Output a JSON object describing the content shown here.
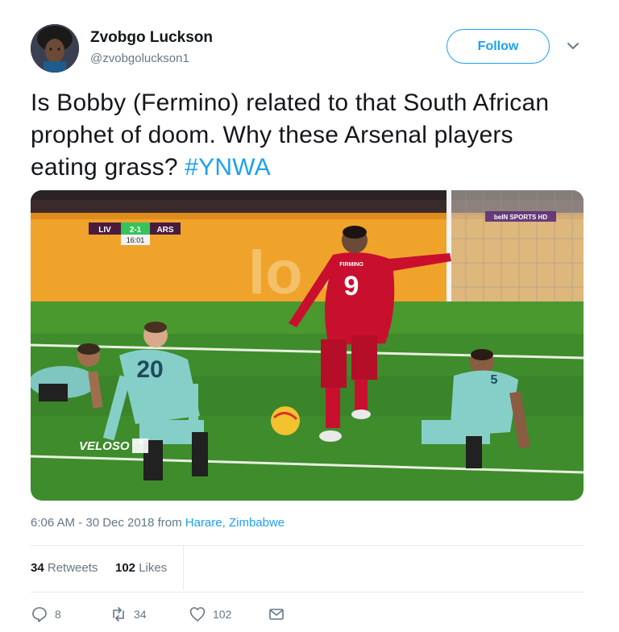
{
  "user": {
    "name": "Zvobgo Luckson",
    "handle": "@zvobgoluckson1",
    "follow_label": "Follow"
  },
  "tweet": {
    "text": "Is Bobby (Fermino) related to that South African prophet of doom. Why these Arsenal players eating grass? ",
    "hashtag": "#YNWA"
  },
  "media": {
    "scoreboard": {
      "home": "LIV",
      "score": "2-1",
      "away": "ARS",
      "time": "16:01"
    },
    "broadcaster": "beIN SPORTS HD",
    "watermark": "VELOSO",
    "banner_text": "lo e",
    "player_name": "FIRMINO",
    "player_number": "9",
    "player_number_2": "20",
    "player_number_3": "5"
  },
  "meta": {
    "time": "6:06 AM - 30 Dec 2018 from ",
    "location": "Harare, Zimbabwe"
  },
  "stats": {
    "retweets_count": "34",
    "retweets_label": "Retweets",
    "likes_count": "102",
    "likes_label": "Likes"
  },
  "actions": {
    "reply_count": "8",
    "retweet_count": "34",
    "like_count": "102"
  },
  "colors": {
    "accent": "#1da1f2",
    "secondary_text": "#657786"
  }
}
